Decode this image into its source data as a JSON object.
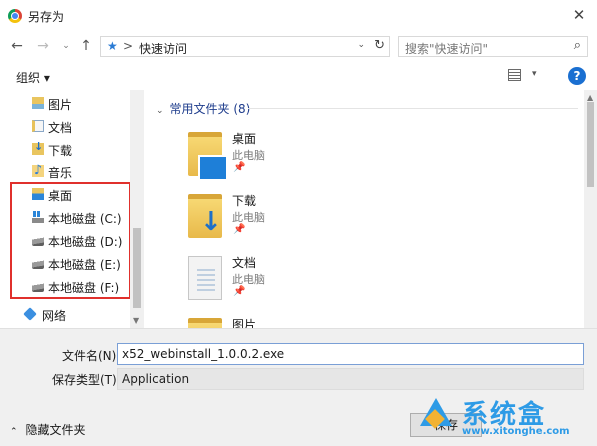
{
  "window": {
    "title": "另存为",
    "close_glyph": "✕"
  },
  "navigation": {
    "back_glyph": "←",
    "forward_glyph": "→",
    "recent_glyph": "⌄",
    "up_glyph": "↑",
    "address_crumb": "快速访问",
    "address_separator": ">",
    "address_dropdown_glyph": "⌄",
    "refresh_glyph": "↻",
    "search_placeholder": "搜索\"快速访问\"",
    "search_glyph": "⌕"
  },
  "toolbar": {
    "organize_label": "组织 ▾",
    "view_caret": "▾",
    "help_label": "?"
  },
  "sidebar": {
    "items": [
      {
        "label": "图片",
        "icon": "pictures-folder-icon"
      },
      {
        "label": "文档",
        "icon": "documents-folder-icon"
      },
      {
        "label": "下载",
        "icon": "downloads-folder-icon"
      },
      {
        "label": "音乐",
        "icon": "music-folder-icon"
      },
      {
        "label": "桌面",
        "icon": "desktop-folder-icon"
      },
      {
        "label": "本地磁盘 (C:)",
        "icon": "windows-drive-icon"
      },
      {
        "label": "本地磁盘 (D:)",
        "icon": "drive-icon"
      },
      {
        "label": "本地磁盘 (E:)",
        "icon": "drive-icon"
      },
      {
        "label": "本地磁盘 (F:)",
        "icon": "drive-icon"
      },
      {
        "label": "网络",
        "icon": "network-icon"
      }
    ],
    "highlight_color": "#e0302c"
  },
  "content": {
    "group_header": "常用文件夹 (8)",
    "group_chevron": "⌄",
    "items": [
      {
        "name": "桌面",
        "sub": "此电脑",
        "pin": "📌",
        "icon": "desktop-folder-icon"
      },
      {
        "name": "下载",
        "sub": "此电脑",
        "pin": "📌",
        "icon": "downloads-folder-icon"
      },
      {
        "name": "文档",
        "sub": "此电脑",
        "pin": "📌",
        "icon": "documents-folder-icon"
      },
      {
        "name": "图片",
        "sub": "",
        "pin": "",
        "icon": "pictures-folder-icon"
      }
    ]
  },
  "form": {
    "filename_label": "文件名(N):",
    "filename_value": "x52_webinstall_1.0.0.2.exe",
    "filetype_label": "保存类型(T):",
    "filetype_value": "Application",
    "hide_folders_label": "隐藏文件夹",
    "hide_folders_chevron": "⌃",
    "save_label": "保存"
  },
  "watermark": {
    "brand": "系统盒",
    "url": "www.xitonghe.com"
  },
  "colors": {
    "accent": "#1a6fd1",
    "folder": "#eac25c",
    "watermark": "#2e9be6"
  }
}
